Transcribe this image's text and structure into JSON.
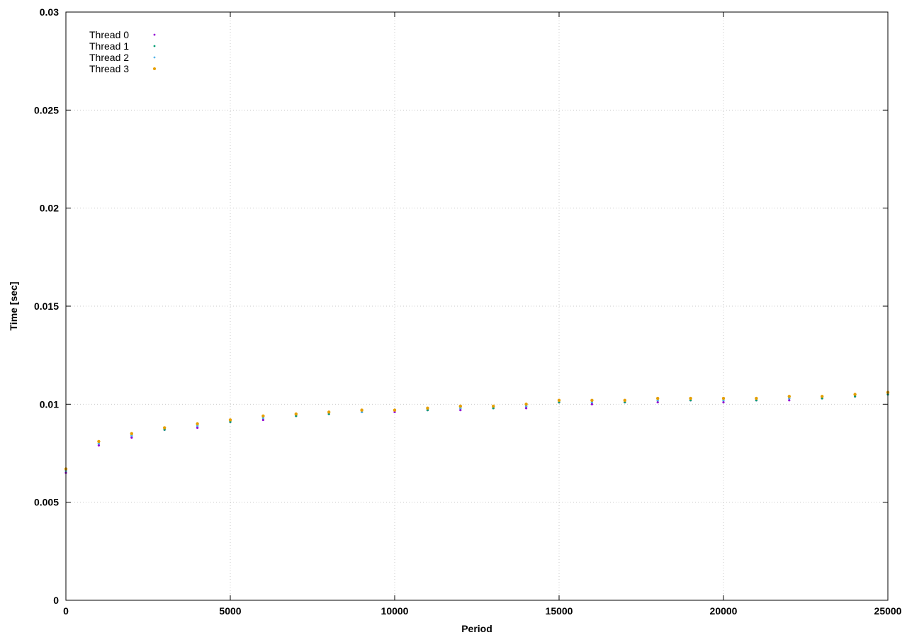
{
  "chart_data": {
    "type": "scatter",
    "title": "",
    "xlabel": "Period",
    "ylabel": "Time [sec]",
    "xlim": [
      0,
      25000
    ],
    "ylim": [
      0,
      0.03
    ],
    "x_ticks": [
      0,
      5000,
      10000,
      15000,
      20000,
      25000
    ],
    "x_tick_labels": [
      "0",
      "5000",
      "10000",
      "15000",
      "20000",
      "25000"
    ],
    "y_ticks": [
      0,
      0.005,
      0.01,
      0.015,
      0.02,
      0.025,
      0.03
    ],
    "y_tick_labels": [
      "0",
      "0.005",
      "0.01",
      "0.015",
      "0.02",
      "0.025",
      "0.03"
    ],
    "grid": true,
    "legend_position": "top-left",
    "series": [
      {
        "name": "Thread 0",
        "color": "#9400d3",
        "x": [
          0,
          1000,
          2000,
          3000,
          4000,
          5000,
          6000,
          7000,
          8000,
          9000,
          10000,
          11000,
          12000,
          13000,
          14000,
          15000,
          16000,
          17000,
          18000,
          19000,
          20000,
          21000,
          22000,
          23000,
          24000,
          25000
        ],
        "y": [
          0.0065,
          0.0079,
          0.0083,
          0.0087,
          0.0088,
          0.0091,
          0.0092,
          0.0094,
          0.0095,
          0.0096,
          0.0096,
          0.0097,
          0.0097,
          0.0098,
          0.0098,
          0.0101,
          0.01,
          0.0101,
          0.0101,
          0.0102,
          0.0101,
          0.0102,
          0.0102,
          0.0103,
          0.0104,
          0.0105
        ]
      },
      {
        "name": "Thread 1",
        "color": "#009e73",
        "x": [
          0,
          1000,
          2000,
          3000,
          4000,
          5000,
          6000,
          7000,
          8000,
          9000,
          10000,
          11000,
          12000,
          13000,
          14000,
          15000,
          16000,
          17000,
          18000,
          19000,
          20000,
          21000,
          22000,
          23000,
          24000,
          25000
        ],
        "y": [
          0.0066,
          0.008,
          0.0084,
          0.0087,
          0.0089,
          0.0091,
          0.0093,
          0.0094,
          0.0095,
          0.0096,
          0.0097,
          0.0097,
          0.0098,
          0.0098,
          0.0099,
          0.0101,
          0.0101,
          0.0101,
          0.0102,
          0.0102,
          0.0102,
          0.0102,
          0.0103,
          0.0103,
          0.0104,
          0.0105
        ]
      },
      {
        "name": "Thread 2",
        "color": "#56b4e9",
        "x": [
          0,
          1000,
          2000,
          3000,
          4000,
          5000,
          6000,
          7000,
          8000,
          9000,
          10000,
          11000,
          12000,
          13000,
          14000,
          15000,
          16000,
          17000,
          18000,
          19000,
          20000,
          21000,
          22000,
          23000,
          24000,
          25000
        ],
        "y": [
          0.0066,
          0.008,
          0.0084,
          0.0088,
          0.0089,
          0.0092,
          0.0093,
          0.0095,
          0.0096,
          0.0096,
          0.0097,
          0.0098,
          0.0098,
          0.0099,
          0.0099,
          0.0102,
          0.0101,
          0.0102,
          0.0102,
          0.0103,
          0.0102,
          0.0103,
          0.0103,
          0.0104,
          0.0105,
          0.0106
        ]
      },
      {
        "name": "Thread 3",
        "color": "#e69f00",
        "x": [
          0,
          1000,
          2000,
          3000,
          4000,
          5000,
          6000,
          7000,
          8000,
          9000,
          10000,
          11000,
          12000,
          13000,
          14000,
          15000,
          16000,
          17000,
          18000,
          19000,
          20000,
          21000,
          22000,
          23000,
          24000,
          25000
        ],
        "y": [
          0.0067,
          0.0081,
          0.0085,
          0.0088,
          0.009,
          0.0092,
          0.0094,
          0.0095,
          0.0096,
          0.0097,
          0.0097,
          0.0098,
          0.0099,
          0.0099,
          0.01,
          0.0102,
          0.0102,
          0.0102,
          0.0103,
          0.0103,
          0.0103,
          0.0103,
          0.0104,
          0.0104,
          0.0105,
          0.0106
        ]
      }
    ]
  }
}
